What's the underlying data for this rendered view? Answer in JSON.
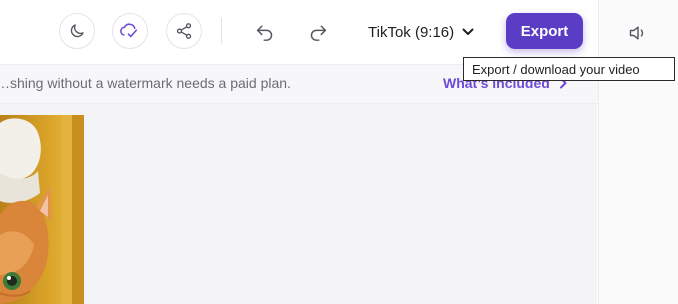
{
  "toolbar": {
    "aspect_label": "TikTok (9:16)",
    "export_label": "Export"
  },
  "tooltip": {
    "text": "Export / download your video"
  },
  "banner": {
    "text": "…shing without a watermark needs a paid plan.",
    "link": "What’s included"
  },
  "colors": {
    "accent": "#5b3cc4",
    "link": "#6d4ad6",
    "sync_icon": "#6d4ad6"
  },
  "icons": [
    "moon-icon",
    "cloud-sync-icon",
    "share-icon",
    "undo-icon",
    "redo-icon",
    "chevron-down-icon",
    "volume-icon",
    "chevron-right-icon"
  ]
}
